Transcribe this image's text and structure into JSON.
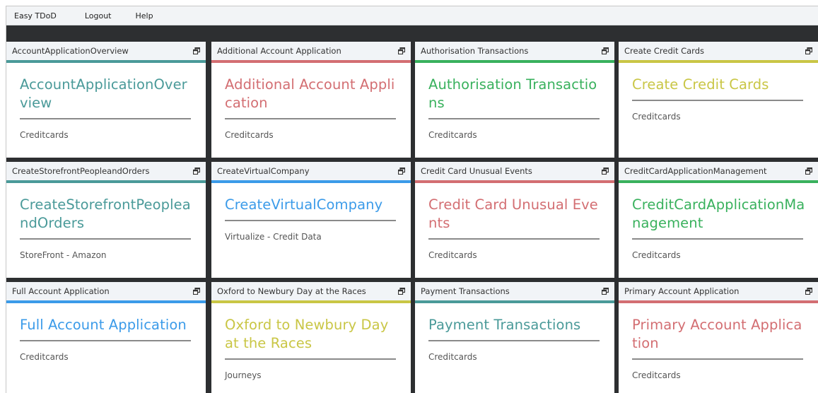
{
  "menu": {
    "items": [
      "Easy TDoD",
      "Logout",
      "Help"
    ]
  },
  "icon": "popout-window-icon",
  "colors": {
    "teal": "#4a9a99",
    "red": "#d36e72",
    "green": "#39b15d",
    "yellow": "#c9c645",
    "blue": "#3b9be9",
    "frame": "#2d2f31"
  },
  "tiles": [
    {
      "header": "AccountApplicationOverview",
      "title": "AccountApplicationOverview",
      "subtitle": "Creditcards",
      "color": "teal"
    },
    {
      "header": "Additional Account Application",
      "title": "Additional Account Application",
      "subtitle": "Creditcards",
      "color": "red"
    },
    {
      "header": "Authorisation Transactions",
      "title": "Authorisation Transactions",
      "subtitle": "Creditcards",
      "color": "green"
    },
    {
      "header": "Create Credit Cards",
      "title": "Create Credit Cards",
      "subtitle": "Creditcards",
      "color": "yellow"
    },
    {
      "header": "CreateStorefrontPeopleandOrders",
      "title": "CreateStorefrontPeopleandOrders",
      "subtitle": "StoreFront - Amazon",
      "color": "teal"
    },
    {
      "header": "CreateVirtualCompany",
      "title": "CreateVirtualCompany",
      "subtitle": "Virtualize - Credit Data",
      "color": "blue"
    },
    {
      "header": "Credit Card Unusual Events",
      "title": "Credit Card Unusual Events",
      "subtitle": "Creditcards",
      "color": "red"
    },
    {
      "header": "CreditCardApplicationManagement",
      "title": "CreditCardApplicationManagement",
      "subtitle": "Creditcards",
      "color": "green"
    },
    {
      "header": "Full Account Application",
      "title": "Full Account Application",
      "subtitle": "Creditcards",
      "color": "blue"
    },
    {
      "header": "Oxford to Newbury Day at the Races",
      "title": "Oxford to Newbury Day at the Races",
      "subtitle": "Journeys",
      "color": "yellow"
    },
    {
      "header": "Payment Transactions",
      "title": "Payment Transactions",
      "subtitle": "Creditcards",
      "color": "teal"
    },
    {
      "header": "Primary Account Application",
      "title": "Primary Account Application",
      "subtitle": "Creditcards",
      "color": "red"
    }
  ]
}
